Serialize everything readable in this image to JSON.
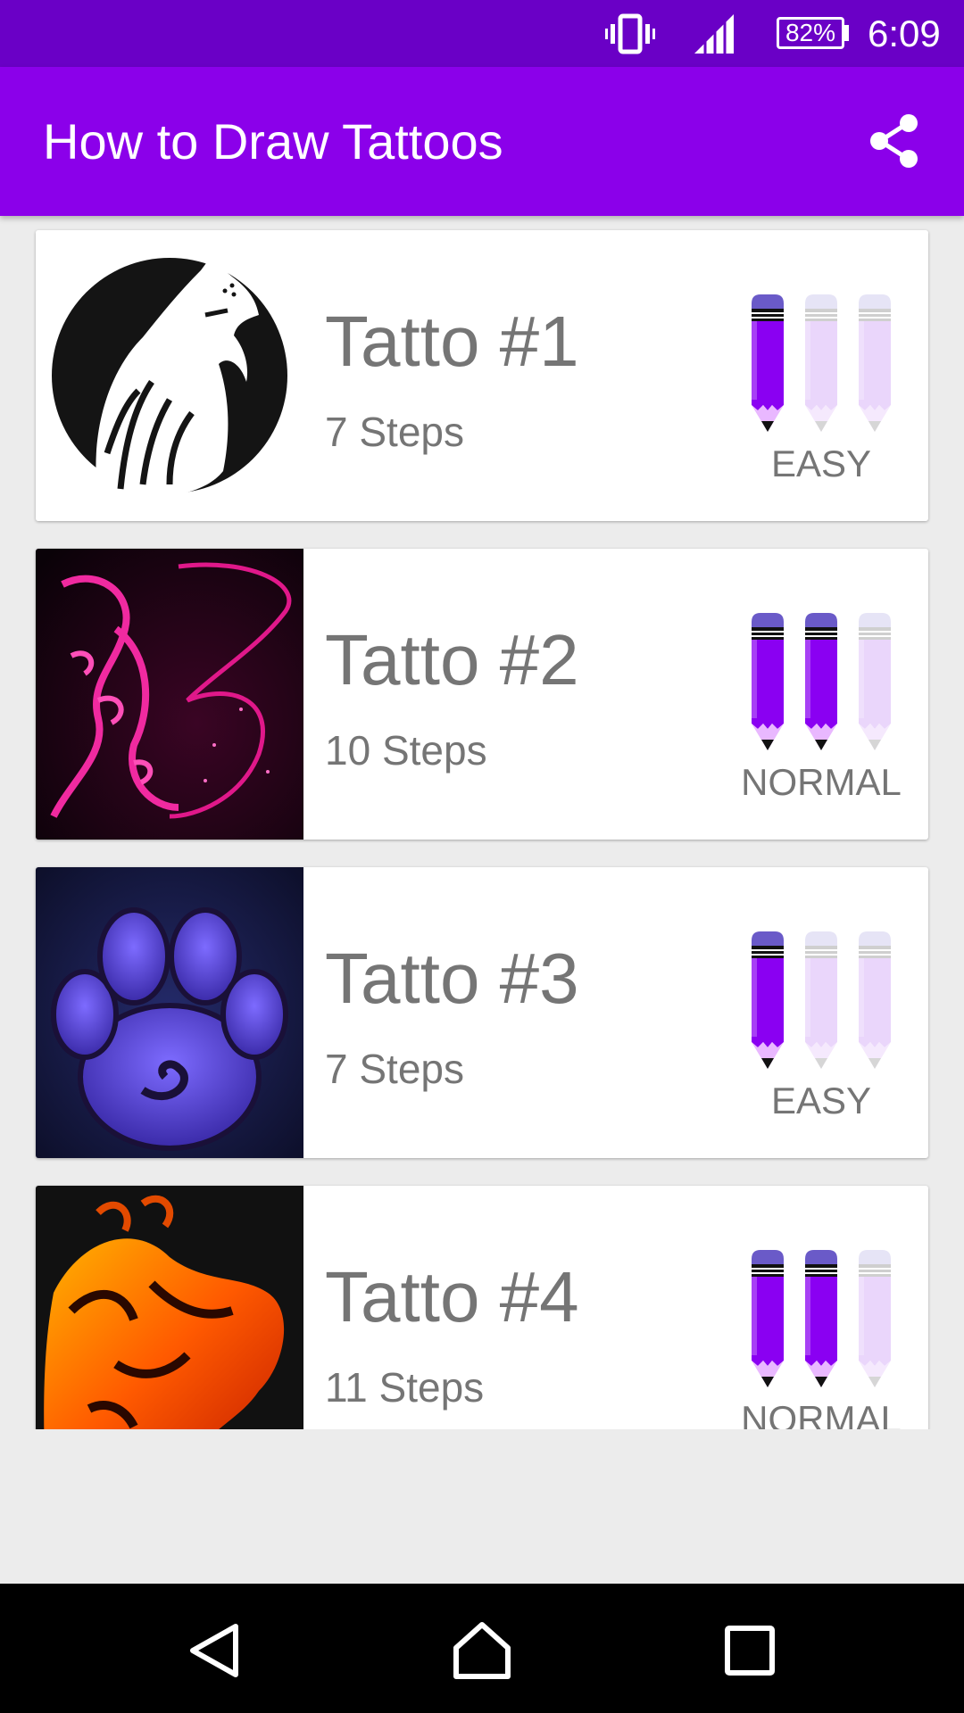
{
  "status_bar": {
    "icons": [
      "vibrate-icon",
      "signal-icon",
      "battery-icon"
    ],
    "battery": "82%",
    "time": "6:09"
  },
  "app_bar": {
    "title": "How to Draw Tattoos",
    "action_icon": "share-icon"
  },
  "colors": {
    "status_bar": "#6a00c6",
    "app_bar": "#8b00ea",
    "pencil_active": "#8a00f2",
    "pencil_inactive": "#ead6fb",
    "text_gray": "#757575"
  },
  "list": {
    "items": [
      {
        "title": "Tatto #1",
        "steps": "7 Steps",
        "difficulty": "EASY",
        "level": 1,
        "max_level": 3,
        "image": "howling-wolf-tattoo"
      },
      {
        "title": "Tatto #2",
        "steps": "10 Steps",
        "difficulty": "NORMAL",
        "level": 2,
        "max_level": 3,
        "image": "pink-fairy-tattoo"
      },
      {
        "title": "Tatto #3",
        "steps": "7 Steps",
        "difficulty": "EASY",
        "level": 1,
        "max_level": 3,
        "image": "purple-paw-tattoo"
      },
      {
        "title": "Tatto #4",
        "steps": "11 Steps",
        "difficulty": "NORMAL",
        "level": 2,
        "max_level": 3,
        "image": "fire-horse-tattoo"
      }
    ]
  },
  "nav_bar": {
    "buttons": [
      "back-icon",
      "home-icon",
      "recents-icon"
    ]
  }
}
